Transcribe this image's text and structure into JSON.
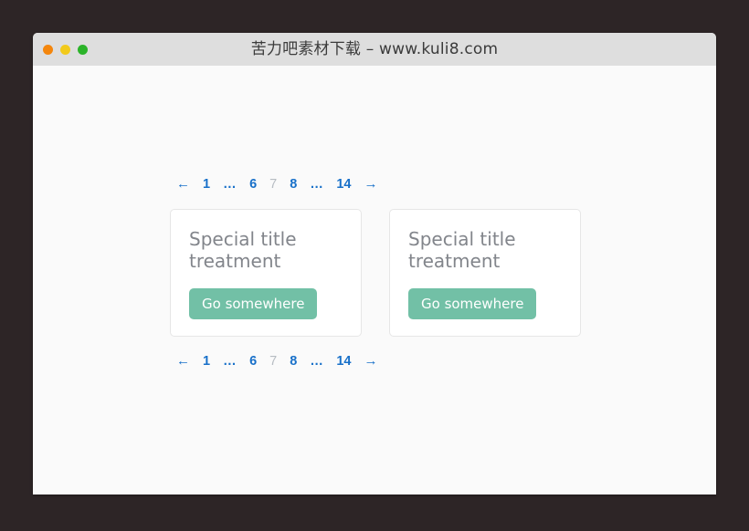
{
  "window": {
    "title": "苦力吧素材下载 – www.kuli8.com",
    "traffic_lights": [
      {
        "name": "close",
        "color": "#f4860d"
      },
      {
        "name": "minimize",
        "color": "#f2ca1b"
      },
      {
        "name": "zoom",
        "color": "#2bb329"
      }
    ]
  },
  "theme": {
    "desktop_background": "#2d2526",
    "titlebar_background": "#dedede",
    "page_background": "#fafafa",
    "card_background": "#ffffff",
    "card_border": "#e6e6e6",
    "link_blue": "#1870c9",
    "muted_gray": "#b6bcc2",
    "heading_gray": "#82858b",
    "button_green": "#72c0a6"
  },
  "pagination_top": {
    "items": [
      {
        "label": "←",
        "kind": "arrow",
        "state": "enabled"
      },
      {
        "label": "1",
        "kind": "page",
        "state": "enabled"
      },
      {
        "label": "…",
        "kind": "ellipsis",
        "state": "enabled"
      },
      {
        "label": "6",
        "kind": "page",
        "state": "enabled"
      },
      {
        "label": "7",
        "kind": "page",
        "state": "disabled"
      },
      {
        "label": "8",
        "kind": "page",
        "state": "enabled"
      },
      {
        "label": "…",
        "kind": "ellipsis",
        "state": "enabled"
      },
      {
        "label": "14",
        "kind": "page",
        "state": "enabled"
      },
      {
        "label": "→",
        "kind": "arrow",
        "state": "enabled"
      }
    ]
  },
  "pagination_bottom": {
    "items": [
      {
        "label": "←",
        "kind": "arrow",
        "state": "enabled"
      },
      {
        "label": "1",
        "kind": "page",
        "state": "enabled"
      },
      {
        "label": "…",
        "kind": "ellipsis",
        "state": "enabled"
      },
      {
        "label": "6",
        "kind": "page",
        "state": "enabled"
      },
      {
        "label": "7",
        "kind": "page",
        "state": "disabled"
      },
      {
        "label": "8",
        "kind": "page",
        "state": "enabled"
      },
      {
        "label": "…",
        "kind": "ellipsis",
        "state": "enabled"
      },
      {
        "label": "14",
        "kind": "page",
        "state": "enabled"
      },
      {
        "label": "→",
        "kind": "arrow",
        "state": "enabled"
      }
    ]
  },
  "cards": [
    {
      "title": "Special title treatment",
      "button_label": "Go somewhere"
    },
    {
      "title": "Special title treatment",
      "button_label": "Go somewhere"
    }
  ]
}
